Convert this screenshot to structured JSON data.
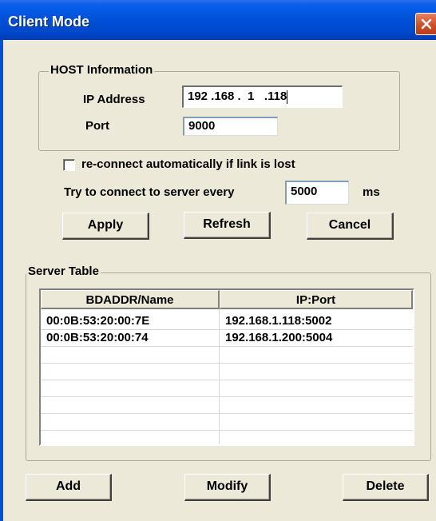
{
  "window": {
    "title": "Client Mode"
  },
  "host_group": {
    "label": "HOST Information",
    "ip_label": "IP Address",
    "ip_value": "192 .168 .  1   .118",
    "port_label": "Port",
    "port_value": "9000"
  },
  "reconnect": {
    "checkbox_label": "re-connect automatically if link is lost",
    "checked": false,
    "interval_label": "Try to connect to server every",
    "interval_value": "5000",
    "unit": "ms"
  },
  "buttons": {
    "apply": "Apply",
    "refresh": "Refresh",
    "cancel": "Cancel"
  },
  "server_table": {
    "label": "Server Table",
    "columns": [
      "BDADDR/Name",
      "IP:Port"
    ],
    "rows": [
      [
        "00:0B:53:20:00:7E",
        "192.168.1.118:5002"
      ],
      [
        "00:0B:53:20:00:74",
        "192.168.1.200:5004"
      ]
    ]
  },
  "bottom_buttons": {
    "add": "Add",
    "modify": "Modify",
    "delete": "Delete"
  },
  "icons": {
    "close": "close-icon"
  },
  "colors": {
    "titlebar": "#0050d8",
    "background": "#ece9d8",
    "close": "#cf4f2a"
  }
}
